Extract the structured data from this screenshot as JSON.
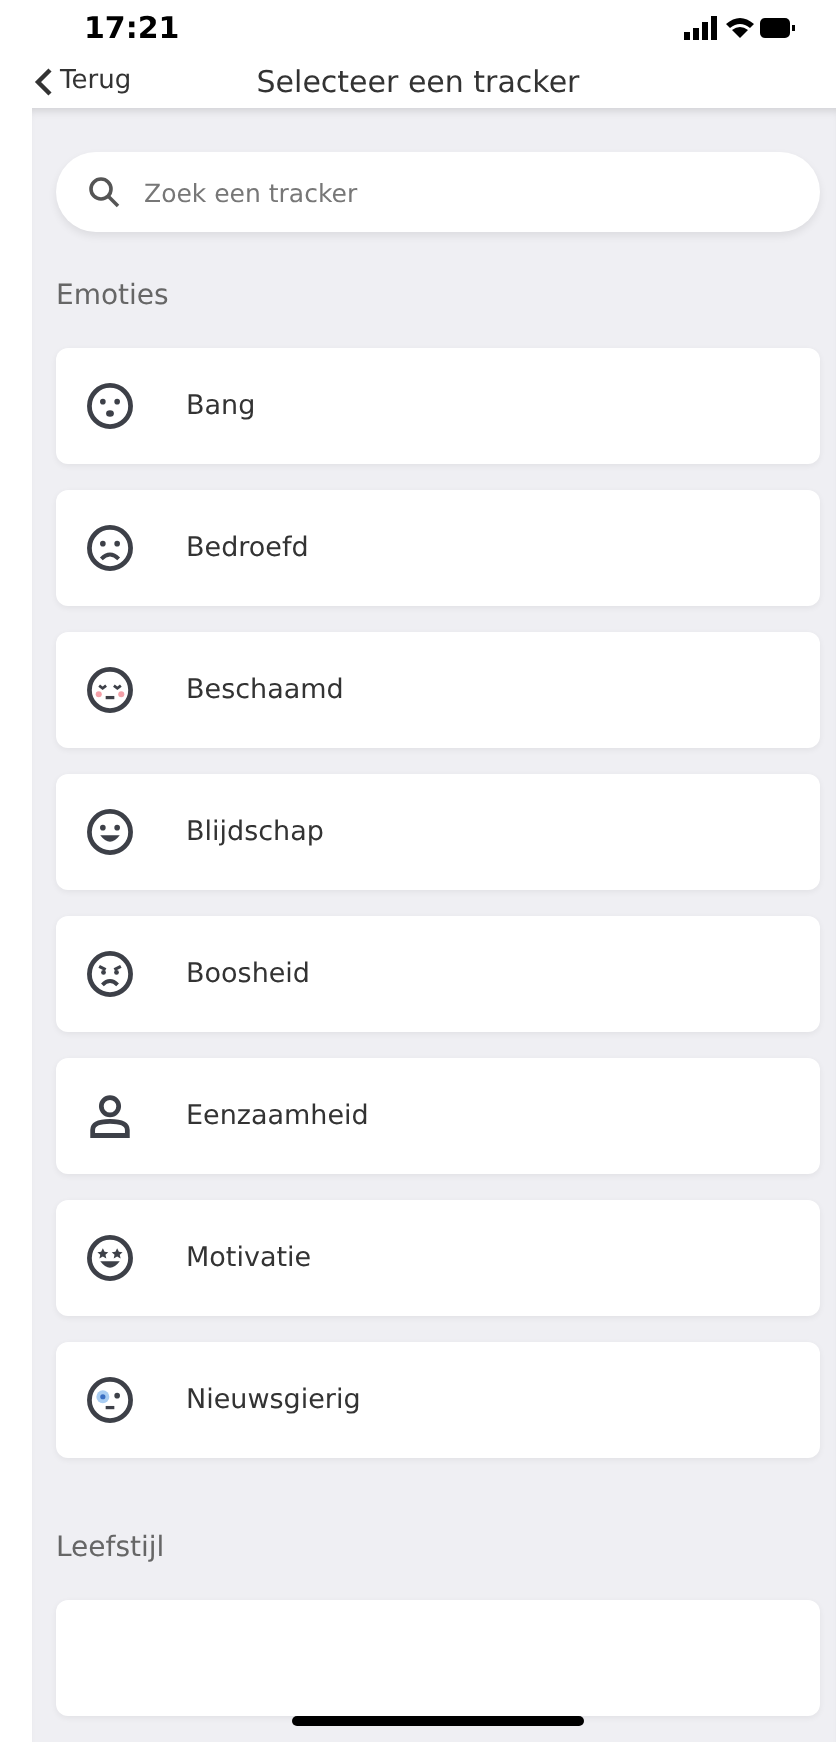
{
  "status_bar": {
    "time": "17:21"
  },
  "nav": {
    "back": "Terug",
    "title": "Selecteer een tracker"
  },
  "search": {
    "placeholder": "Zoek een tracker"
  },
  "sections": [
    {
      "title": "Emoties",
      "items": [
        {
          "label": "Bang",
          "kind": "scared"
        },
        {
          "label": "Bedroefd",
          "kind": "sad"
        },
        {
          "label": "Beschaamd",
          "kind": "ashamed"
        },
        {
          "label": "Blijdschap",
          "kind": "happy"
        },
        {
          "label": "Boosheid",
          "kind": "angry"
        },
        {
          "label": "Eenzaamheid",
          "kind": "person"
        },
        {
          "label": "Motivatie",
          "kind": "stars"
        },
        {
          "label": "Nieuwsgierig",
          "kind": "curious"
        }
      ]
    },
    {
      "title": "Leefstijl",
      "items": [
        {
          "kind": "partial"
        }
      ]
    }
  ]
}
